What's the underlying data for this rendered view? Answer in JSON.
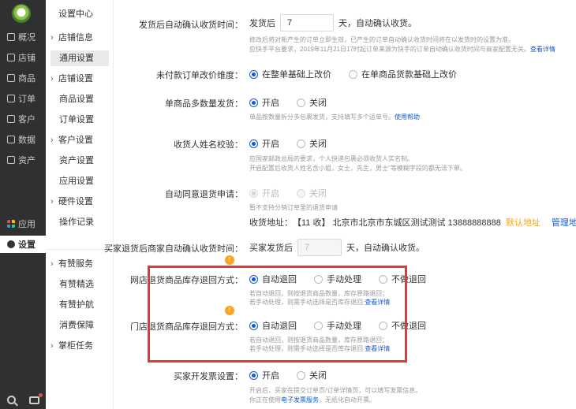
{
  "rail": {
    "items": [
      "概况",
      "店铺",
      "商品",
      "订单",
      "客户",
      "数据",
      "资产"
    ],
    "apps": "应用",
    "settings": "设置"
  },
  "subnav": {
    "title": "设置中心",
    "store_info": "店铺信息",
    "general": "通用设置",
    "store_settings": "店铺设置",
    "product_settings": "商品设置",
    "order_settings": "订单设置",
    "customer_settings": "客户设置",
    "asset_settings": "资产设置",
    "app_settings": "应用设置",
    "hardware_settings": "硬件设置",
    "operation_log": "操作记录",
    "youzan_service": "有赞服务",
    "youzan_select": "有赞精选",
    "youzan_guard": "有赞护航",
    "consumer_protection": "消费保障",
    "cabinet_tasks": "掌柜任务"
  },
  "form": {
    "auto_confirm": {
      "label": "发货后自动确认收货时间：",
      "prefix": "发货后",
      "value": "7",
      "suffix": "天，自动确认收货。",
      "hint1": "修改后将对新产生的订单立即生效，已产生的订单自动确认收货时间将在以发货时的设置为准。",
      "hint2": "应快手平台要求，2019年11月21日17时起订单来源为快手的订单自动确认收货时间与商家配置无关。",
      "hint2_link": "查看详情"
    },
    "unpaid_price": {
      "label": "未付款订单改价维度：",
      "opt1": "在整单基础上改价",
      "opt2": "在单商品货款基础上改价"
    },
    "multi_qty": {
      "label": "单商品多数量发货：",
      "on": "开启",
      "off": "关闭",
      "hint": "单品按数量拆分多包裹发货，支持填写多个运单号。",
      "hint_link": "使用帮助"
    },
    "name_check": {
      "label": "收货人姓名校验：",
      "on": "开启",
      "off": "关闭",
      "hint1": "应国家邮政总局的要求，个人快递包裹必须收货人实名制。",
      "hint2": "开启配置后收货人姓名含小姐，女士，先生，男士\"等模糊字段的都无法下单。"
    },
    "auto_agree": {
      "label": "自动同意退货申请：",
      "on": "开启",
      "off": "关闭",
      "hint": "暂不支持分销订单里的退货申请",
      "addr_label": "收货地址：",
      "addr_value": "【11 收】 北京市北京市东城区测试测试 13888888888",
      "default_addr": "默认地址",
      "manage_addr": "管理地址"
    },
    "buyer_return": {
      "label": "买家退货后商家自动确认收货时间：",
      "prefix": "买家发货后",
      "value": "7",
      "suffix": "天，自动确认收货。"
    },
    "online_stock": {
      "label": "网店退货商品库存退回方式：",
      "opt1": "自动退回",
      "opt2": "手动处理",
      "opt3": "不做退回",
      "hint1": "若自动退回，则按退货商品数量，库存原路退回；",
      "hint2": "若手动处理，则需手动选择是否库存退回",
      "hint_link": "查看详情"
    },
    "store_stock": {
      "label": "门店退货商品库存退回方式：",
      "opt1": "自动退回",
      "opt2": "手动处理",
      "opt3": "不做退回",
      "hint1": "若自动退回，则按退货商品数量，库存原路退回；",
      "hint2": "若手动处理，则需手动选择是否库存退回",
      "hint_link": "查看详情"
    },
    "invoice": {
      "label": "买家开发票设置：",
      "on": "开启",
      "off": "关闭",
      "hint1": "开启后，买家在提交订单页/订单详情页，可以填写发票信息。",
      "hint2_pre": "你正在使用",
      "hint2_link": "电子发票服务",
      "hint2_post": "，无纸化自动开票。"
    },
    "badge": "!"
  },
  "colors": {
    "accent": "#155bd4",
    "highlight": "#e23b2e",
    "warning": "#f5a623"
  }
}
